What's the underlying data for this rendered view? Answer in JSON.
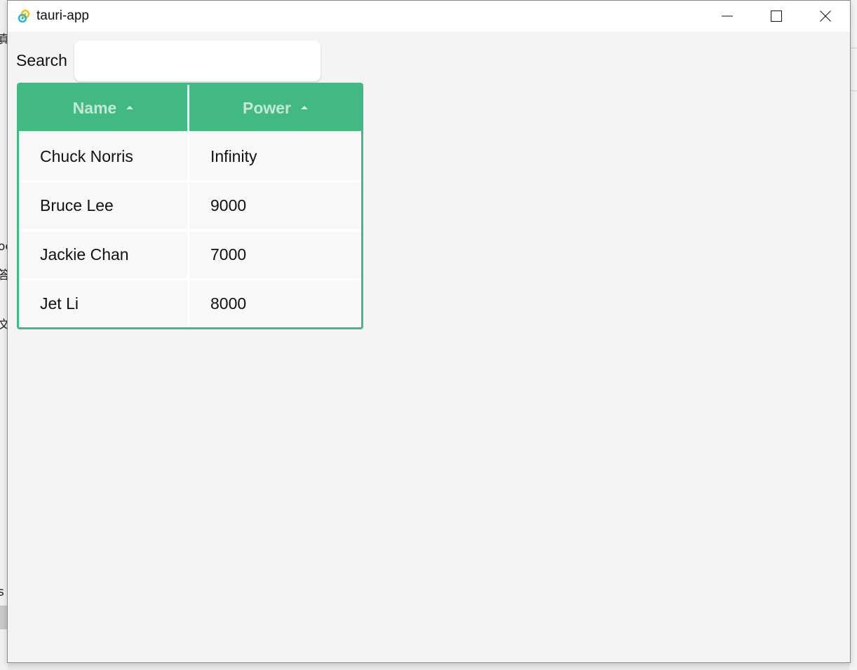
{
  "window": {
    "title": "tauri-app"
  },
  "search": {
    "label": "Search",
    "value": "",
    "placeholder": ""
  },
  "table": {
    "columns": [
      {
        "label": "Name",
        "sort": "ascending"
      },
      {
        "label": "Power",
        "sort": "ascending"
      }
    ],
    "rows": [
      {
        "name": "Chuck Norris",
        "power": "Infinity"
      },
      {
        "name": "Bruce Lee",
        "power": "9000"
      },
      {
        "name": "Jackie Chan",
        "power": "7000"
      },
      {
        "name": "Jet Li",
        "power": "8000"
      }
    ]
  },
  "background_fragments": [
    "真",
    "oc",
    "答",
    "文",
    "s"
  ],
  "colors": {
    "accent": "#42b883",
    "content_bg": "#f4f4f4",
    "header_text": "#ffffff",
    "row_bg": "#f8f8f8"
  },
  "icons": {
    "app": "tauri-logo-icon",
    "minimize": "minimize-icon",
    "maximize": "maximize-icon",
    "close": "close-icon",
    "sort": "sort-ascending-icon"
  }
}
